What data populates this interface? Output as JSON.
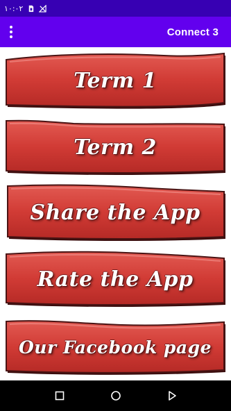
{
  "status_bar": {
    "time": "١٠:٠٢",
    "icons": [
      "sim-card-icon",
      "no-signal-icon"
    ]
  },
  "app_bar": {
    "overflow_icon": "more-vert-icon",
    "title": "Connect 3"
  },
  "menu": {
    "items": [
      {
        "label": "Term 1"
      },
      {
        "label": "Term 2"
      },
      {
        "label": "Share the App"
      },
      {
        "label": "Rate the App"
      },
      {
        "label": "Our Facebook page"
      }
    ]
  },
  "nav_bar": {
    "icons": [
      "recents-icon",
      "home-icon",
      "back-icon"
    ]
  },
  "colors": {
    "status_bar": "#3700b3",
    "app_bar": "#6200ee",
    "button_red": "#d9413b",
    "button_dark_red": "#8e1d1d"
  }
}
